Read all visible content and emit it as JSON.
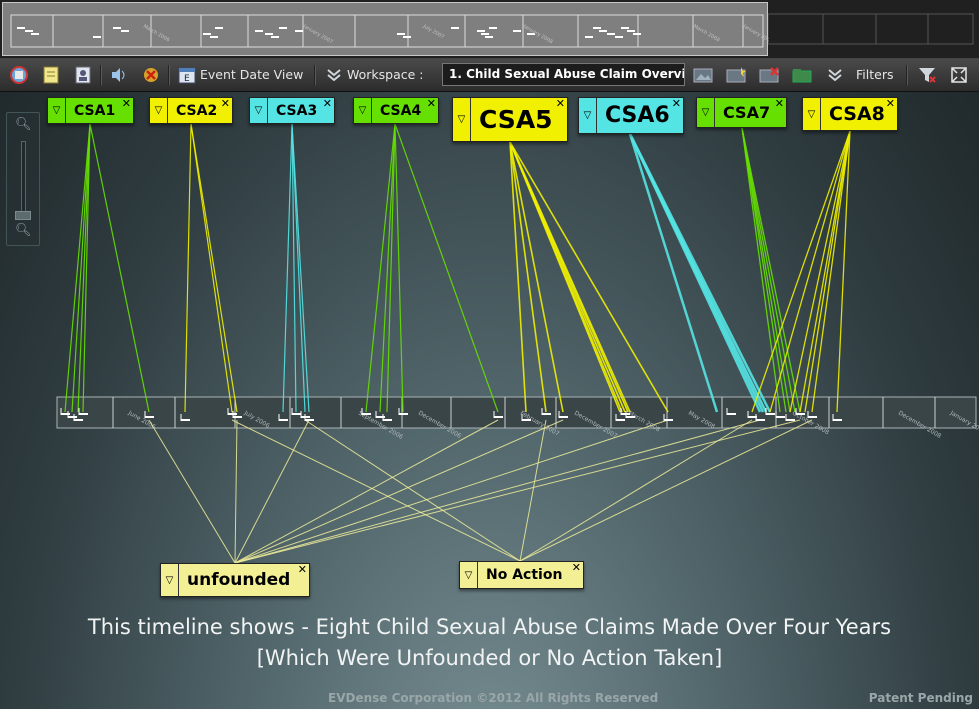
{
  "toolbar": {
    "event_date_view": "Event Date View",
    "workspace_label": "Workspace :",
    "workspace_value": "1. Child Sexual Abuse Claim Overview",
    "filters": "Filters"
  },
  "tags": [
    {
      "label": "CSA1",
      "color": "#66e000"
    },
    {
      "label": "CSA2",
      "color": "#f0f000"
    },
    {
      "label": "CSA3",
      "color": "#55e4e4"
    },
    {
      "label": "CSA4",
      "color": "#66e000"
    },
    {
      "label": "CSA5",
      "color": "#f0f000"
    },
    {
      "label": "CSA6",
      "color": "#55e4e4"
    },
    {
      "label": "CSA7",
      "color": "#66e000"
    },
    {
      "label": "CSA8",
      "color": "#f0f000"
    },
    {
      "label": "unfounded",
      "color": "#f3ef95"
    },
    {
      "label": "No Action",
      "color": "#f3ef95"
    }
  ],
  "timeline": {
    "months": [
      "June 2006",
      "July 2006",
      "September 2006",
      "December 2006",
      "February 2007",
      "December 2007",
      "March 2008",
      "May 2008",
      "October 2008",
      "December 2008",
      "January 2009"
    ]
  },
  "overview": {
    "months": [
      "March 2006",
      "January 2007",
      "July 2007",
      "January 2008",
      "March 2008",
      "January 2009"
    ]
  },
  "caption": {
    "line1": "This timeline shows - Eight Child Sexual Abuse Claims Made Over Four Years",
    "line2": "[Which Were Unfounded or No Action Taken]"
  },
  "footer": {
    "copyright": "EVDense Corporation ©2012 All Rights Reserved",
    "patent": "Patent Pending"
  },
  "icons": [
    "app-icon",
    "notes-icon",
    "contact-card-icon",
    "audio-icon",
    "delete-icon",
    "calendar-icon",
    "chevron-down-icon",
    "image-icon",
    "new-image-icon",
    "remove-image-icon",
    "folder-icon",
    "filter-icon",
    "fullscreen-icon",
    "zoom-in-icon",
    "zoom-out-icon"
  ]
}
